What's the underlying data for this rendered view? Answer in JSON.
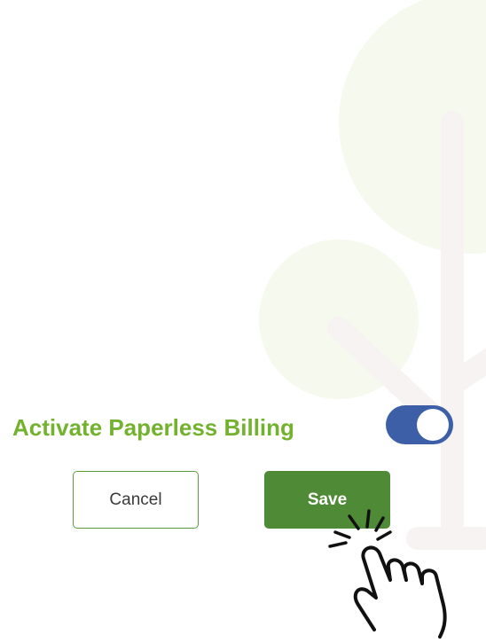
{
  "setting": {
    "label": "Activate Paperless Billing",
    "enabled": true
  },
  "actions": {
    "cancel_label": "Cancel",
    "save_label": "Save"
  },
  "colors": {
    "label_green": "#73b22e",
    "toggle_on": "#3c5fa8",
    "save_bg": "#4f8a37",
    "cancel_border": "#5c9b3c",
    "tree_leaf": "#f6f9ee",
    "tree_trunk": "#f7f3f2"
  },
  "icons": {
    "decoration": "tree-illustration-icon",
    "pointer": "tap-hand-icon"
  }
}
